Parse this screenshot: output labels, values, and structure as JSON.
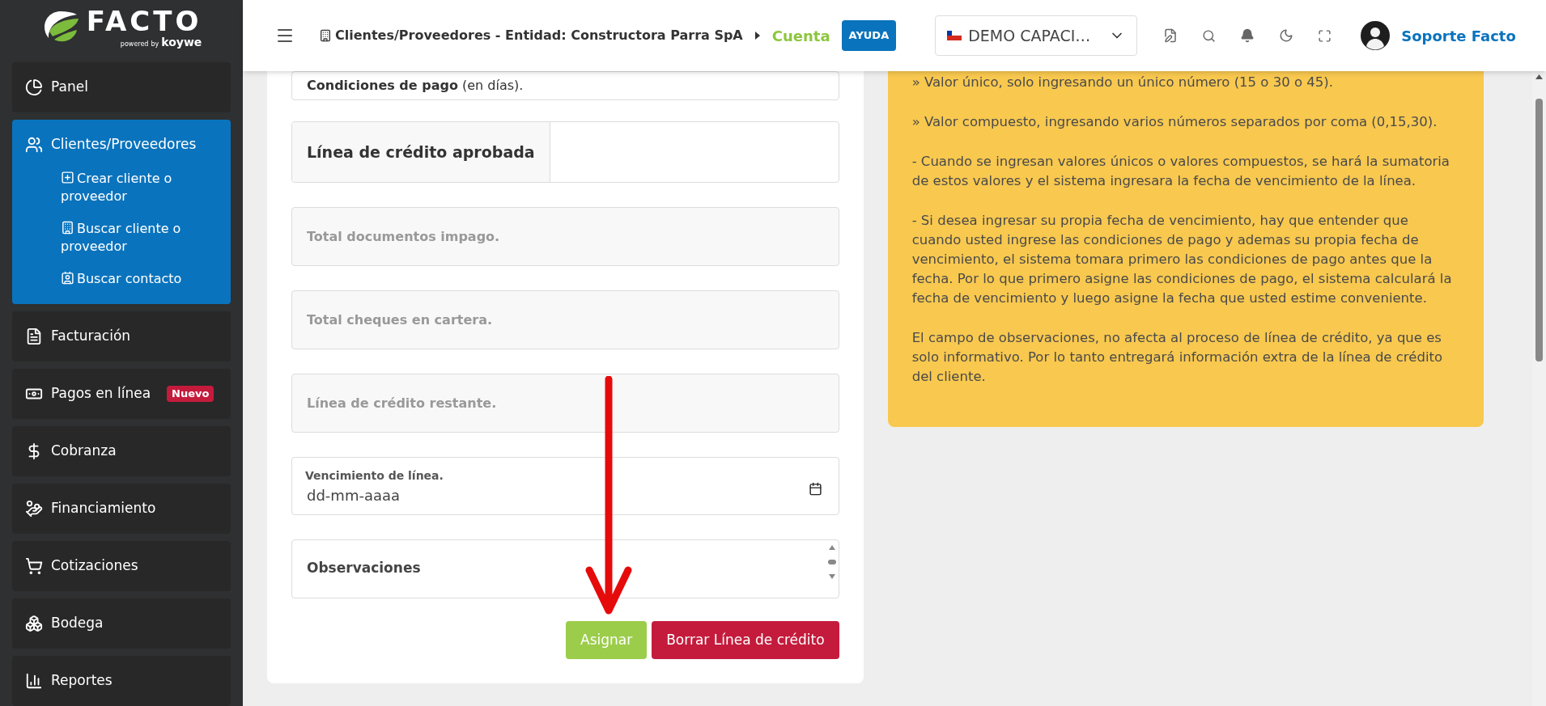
{
  "logo": {
    "name": "FACTO",
    "powered": "powered",
    "by": "by",
    "brand": "koywe"
  },
  "sidebar": {
    "items": [
      {
        "label": "Panel",
        "selected": false
      },
      {
        "label": "Clientes/Proveedores",
        "selected": true,
        "children": [
          {
            "label": "Crear cliente o proveedor"
          },
          {
            "label": "Buscar cliente o proveedor"
          },
          {
            "label": "Buscar contacto"
          }
        ]
      },
      {
        "label": "Facturación",
        "selected": false
      },
      {
        "label": "Pagos en línea",
        "selected": false,
        "badge": "Nuevo"
      },
      {
        "label": "Cobranza",
        "selected": false
      },
      {
        "label": "Financiamiento",
        "selected": false
      },
      {
        "label": "Cotizaciones",
        "selected": false
      },
      {
        "label": "Bodega",
        "selected": false
      },
      {
        "label": "Reportes",
        "selected": false
      }
    ]
  },
  "header": {
    "breadcrumb": {
      "path": "Clientes/Proveedores - Entidad: Constructora Parra SpA",
      "current": "Cuenta"
    },
    "help_button": "AYUDA",
    "company_select": {
      "value": "DEMO CAPACI…"
    },
    "user": "Soporte Facto"
  },
  "form": {
    "fields": [
      {
        "kind": "text",
        "label": "**Condiciones de pago** (en días)."
      },
      {
        "kind": "group",
        "label": "Línea de crédito aprobada"
      },
      {
        "kind": "readonly",
        "placeholder": "Total documentos impago."
      },
      {
        "kind": "readonly",
        "placeholder": "Total cheques en cartera."
      },
      {
        "kind": "readonly",
        "placeholder": "Línea de crédito restante."
      },
      {
        "kind": "date",
        "label": "Vencimiento de línea.",
        "value": "dd-mm-aaaa"
      },
      {
        "kind": "textarea",
        "placeholder": "Observaciones"
      }
    ],
    "buttons": [
      {
        "label": "Asignar",
        "kind": "primary"
      },
      {
        "label": "Borrar Línea de crédito",
        "kind": "danger"
      }
    ]
  },
  "help": {
    "paragraphs": [
      "» Valor único, solo ingresando un único número (15 o 30 o 45).",
      "» Valor compuesto, ingresando varios números separados por coma (0,15,30).",
      "- Cuando se ingresan valores únicos o valores compuestos, se hará la sumatoria de estos valores y el sistema ingresara la fecha de vencimiento de la línea.",
      "- Si desea ingresar su propia fecha de vencimiento, hay que entender que cuando usted ingrese las condiciones de pago y ademas su propia fecha de vencimiento, el sistema tomara primero las condiciones de pago antes que la fecha. Por lo que primero asigne las condiciones de pago, el sistema calculará la fecha de vencimiento y luego asigne la fecha que usted estime conveniente.",
      "El campo de observaciones, no afecta al proceso de línea de crédito, ya que es solo informativo. Por lo tanto entregará información extra de la línea de crédito del cliente."
    ]
  }
}
